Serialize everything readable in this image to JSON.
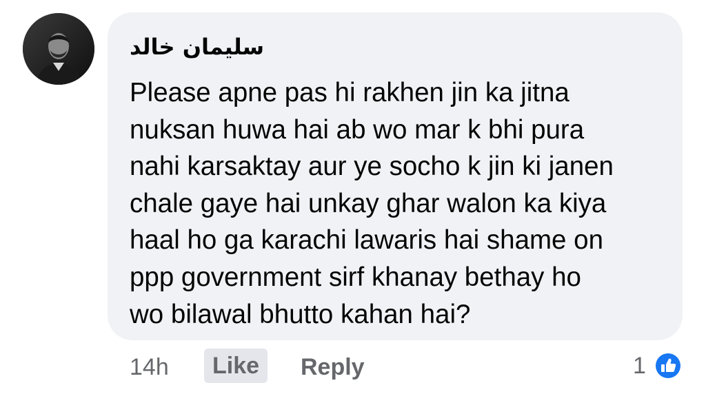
{
  "comment": {
    "author": "سلیمان خالد",
    "text_lines": [
      "Please apne pas hi rakhen jin ka jitna",
      "nuksan huwa hai ab wo mar k bhi pura",
      "nahi karsaktay aur ye socho k jin ki janen",
      "chale gaye hai unkay ghar walon ka kiya",
      "haal ho ga karachi lawaris hai shame on",
      "ppp government sirf khanay bethay ho",
      "wo bilawal bhutto kahan hai?"
    ]
  },
  "actions": {
    "time": "14h",
    "like_label": "Like",
    "reply_label": "Reply"
  },
  "reactions": {
    "count": "1",
    "icon": "thumbs-up-icon",
    "color": "#1877f2"
  },
  "colors": {
    "bubble": "#f0f2f5",
    "text": "#050505",
    "secondary": "#65676b"
  }
}
